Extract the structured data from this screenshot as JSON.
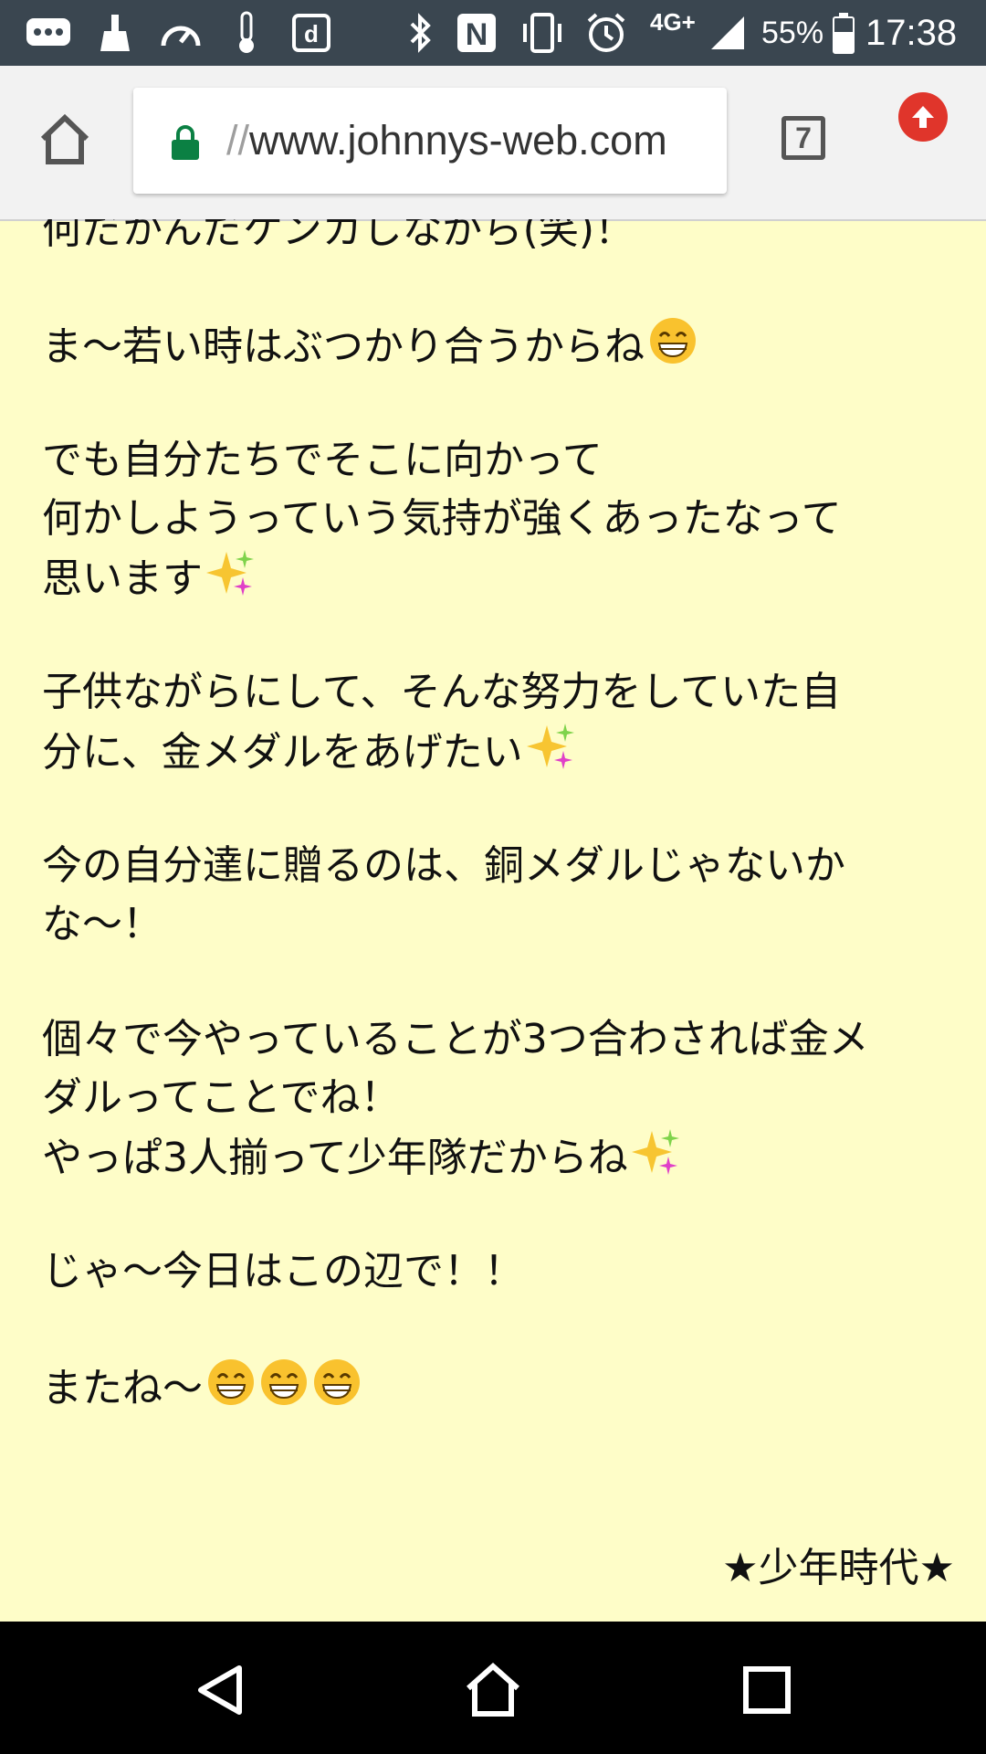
{
  "status_bar": {
    "network": "4G+",
    "battery": "55%",
    "time": "17:38",
    "icons": [
      "chat-icon",
      "broom-icon",
      "speedometer-icon",
      "thermometer-icon",
      "d-app-icon",
      "bluetooth-icon",
      "nfc-icon",
      "vibrate-icon",
      "alarm-icon",
      "signal-icon",
      "battery-icon"
    ]
  },
  "browser": {
    "url_scheme": "//",
    "url_host": "www.johnnys-web.com",
    "tab_count": "7",
    "icons": [
      "home-icon",
      "lock-icon",
      "tabs-icon",
      "update-icon"
    ]
  },
  "content": {
    "lines": [
      "何だかんだケンカしながら(笑)！",
      "ま〜若い時はぶつかり合うからね",
      "でも自分たちでそこに向かって",
      "何かしようっていう気持が強くあったなって",
      "思います",
      "子供ながらにして、そんな努力をしていた自",
      "分に、金メダルをあげたい",
      "今の自分達に贈るのは、銅メダルじゃないか",
      "な〜！",
      "個々で今やっていることが3つ合わされば金メ",
      "ダルってことでね！",
      "やっぱ3人揃って少年隊だからね",
      "じゃ〜今日はこの辺で！！",
      "またね〜"
    ],
    "signature": "★少年時代★",
    "emoji": [
      "grin-emoji",
      "sparkles-emoji"
    ]
  },
  "nav": {
    "icons": [
      "back-icon",
      "home-icon",
      "recents-icon"
    ]
  },
  "colors": {
    "page_bg": "#fefdc8",
    "status_bg": "#3a4650",
    "toolbar_bg": "#f2f2f2",
    "lock": "#0b8043",
    "update": "#e0352b"
  }
}
